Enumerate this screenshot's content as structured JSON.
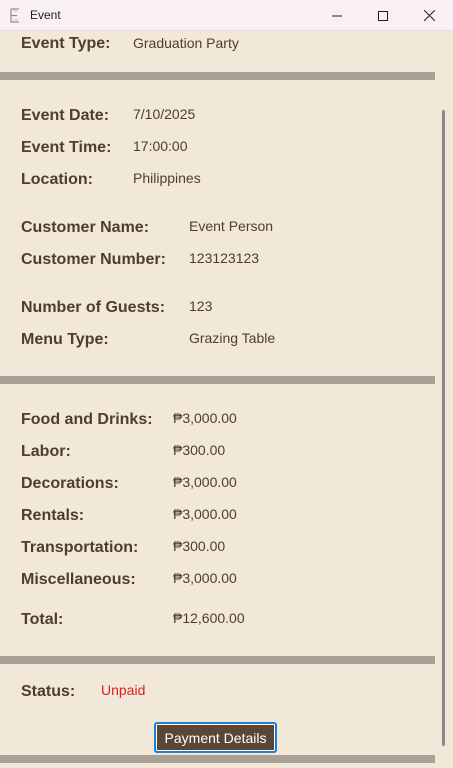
{
  "window": {
    "title": "Event"
  },
  "event": {
    "type": {
      "label": "Event Type:",
      "value": "Graduation Party"
    },
    "date": {
      "label": "Event Date:",
      "value": "7/10/2025"
    },
    "time": {
      "label": "Event Time:",
      "value": "17:00:00"
    },
    "location": {
      "label": "Location:",
      "value": "Philippines"
    }
  },
  "customer": {
    "name": {
      "label": "Customer Name:",
      "value": "Event Person"
    },
    "number": {
      "label": "Customer Number:",
      "value": "123123123"
    }
  },
  "details": {
    "guests": {
      "label": "Number of Guests:",
      "value": "123"
    },
    "menu": {
      "label": "Menu Type:",
      "value": "Grazing Table"
    }
  },
  "costs": {
    "food": {
      "label": "Food and Drinks:",
      "value": "₱3,000.00"
    },
    "labor": {
      "label": "Labor:",
      "value": "₱300.00"
    },
    "decorations": {
      "label": "Decorations:",
      "value": "₱3,000.00"
    },
    "rentals": {
      "label": "Rentals:",
      "value": "₱3,000.00"
    },
    "transportation": {
      "label": "Transportation:",
      "value": "₱300.00"
    },
    "misc": {
      "label": "Miscellaneous:",
      "value": "₱3,000.00"
    },
    "total": {
      "label": "Total:",
      "value": "₱12,600.00"
    }
  },
  "status": {
    "label": "Status:",
    "value": "Unpaid",
    "color": "#e11e1e"
  },
  "actions": {
    "payment_details_label": "Payment Details"
  },
  "colors": {
    "background": "#f1e8da",
    "text": "#4e3d30",
    "divider": "#aaa194",
    "button": "#5b4535"
  }
}
